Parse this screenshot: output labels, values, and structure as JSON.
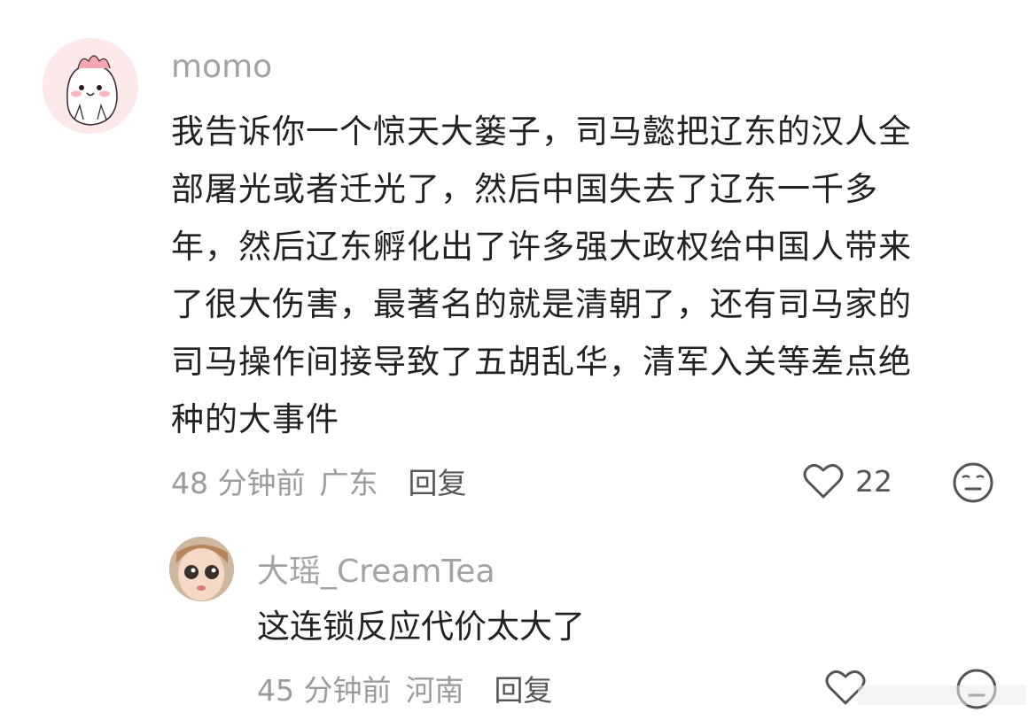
{
  "comments": [
    {
      "username": "momo",
      "text": "我告诉你一个惊天大篓子，司马懿把辽东的汉人全\n部屠光或者迁光了，然后中国失去了辽东一千多\n年，然后辽东孵化出了许多强大政权给中国人带来\n了很大伤害，最著名的就是清朝了，还有司马家的\n司马操作间接导致了五胡乱华，清军入关等差点绝\n种的大事件",
      "time": "48 分钟前",
      "location": "广东",
      "reply_label": "回复",
      "likes": "22",
      "avatar_icon": "pink-cartoon-dinosaur-avatar",
      "like_icon": "heart-outline-icon",
      "emoji_icon": "meh-face-icon"
    },
    {
      "username": "大瑶_CreamTea",
      "text": "这连锁反应代价太大了",
      "time": "45 分钟前",
      "location": "河南",
      "reply_label": "回复",
      "avatar_icon": "doll-avatar",
      "like_icon": "heart-outline-icon",
      "emoji_icon": "meh-face-icon"
    }
  ],
  "colors": {
    "username": "#a3a3a3",
    "body": "#222222",
    "meta": "#9b9b9b",
    "avatar_pink": "#fde8ea"
  }
}
